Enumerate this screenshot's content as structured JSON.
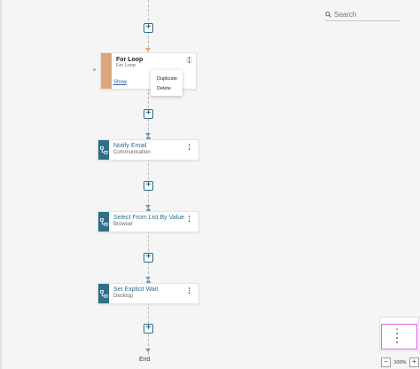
{
  "search": {
    "placeholder": "Search"
  },
  "loop_block": {
    "title": "For Loop",
    "subtitle": "For Loop",
    "show_link": "Show",
    "menu": [
      "Duplicate",
      "Delete"
    ]
  },
  "steps": [
    {
      "title": "Notify Email",
      "subtitle": "Communication"
    },
    {
      "title": "Select From List By Value",
      "subtitle": "Browser"
    },
    {
      "title": "Set Explicit Wait",
      "subtitle": "Desktop"
    }
  ],
  "end_label": "End",
  "zoom": {
    "minus": "−",
    "value": "100%",
    "plus": "+"
  },
  "colors": {
    "accent": "#2f6f87",
    "loop": "#dea47d",
    "minimap_view": "#e35be0"
  },
  "icons": {
    "step": "workflow-icon",
    "search": "search-icon",
    "more": "kebab-menu-icon"
  }
}
